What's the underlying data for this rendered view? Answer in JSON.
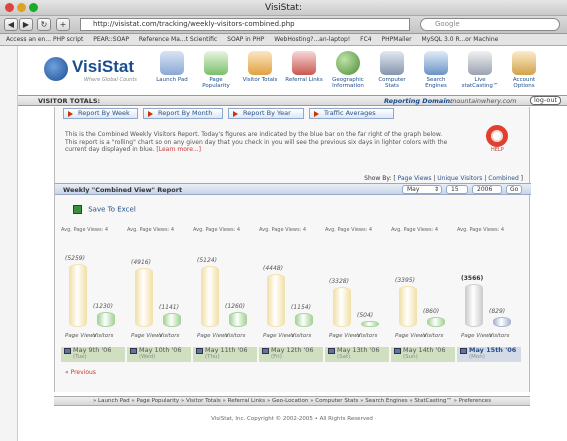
{
  "window": {
    "title": "VisiStat:"
  },
  "browser": {
    "url": "http://visistat.com/tracking/weekly-visitors-combined.php",
    "search_placeholder": "Google",
    "bookmarks": [
      "Access an en... PHP script",
      "PEAR::SOAP",
      "Reference Ma...t Scientific",
      "SOAP in PHP",
      "WebHosting?...an-laptop!",
      "FC4",
      "PHPMailer",
      "MySQL 3.0 R...or Machine"
    ]
  },
  "app": {
    "logo_text": "VisiStat",
    "tagline": "Where Global Counts",
    "nav": [
      {
        "label": "Launch Pad",
        "icon": "rocket-icon"
      },
      {
        "label": "Page Popularity",
        "icon": "page-icon"
      },
      {
        "label": "Visitor Totals",
        "icon": "bar-chart-icon"
      },
      {
        "label": "Referral Links",
        "icon": "funnel-icon"
      },
      {
        "label": "Geographic Information",
        "icon": "globe-icon"
      },
      {
        "label": "Computer Stats",
        "icon": "computer-icon"
      },
      {
        "label": "Search Engines",
        "icon": "magnifier-icon"
      },
      {
        "label": "Live statCasting™",
        "icon": "satellite-icon"
      },
      {
        "label": "Account Options",
        "icon": "gears-icon"
      }
    ],
    "totals_label": "VISITOR TOTALS:",
    "reporting_domain_label": "Reporting Domain:",
    "reporting_domain": "mountainwhery.com",
    "logout_label": "log-out"
  },
  "tabs": [
    "Report By Week",
    "Report By Month",
    "Report By Year",
    "Traffic Averages"
  ],
  "intro": {
    "text": "This is the Combined Weekly Visitors Report. Today's figures are indicated by the blue bar on the far right of the graph below. This report is a \"rolling\" chart so on any given day that you check in you will see the previous six days in lighter colors with the current day displayed in blue.",
    "learn_more": "[Learn more...]",
    "help_label": "HELP"
  },
  "showby": {
    "label": "Show By:",
    "options": [
      "Page Views",
      "Unique Visitors",
      "Combined"
    ]
  },
  "report": {
    "title": "Weekly \"Combined View\" Report",
    "month": "May",
    "day": "15",
    "year": "2006",
    "go": "Go",
    "export": "Save To Excel"
  },
  "chart_data": {
    "type": "bar",
    "column_headers": [
      "Avg. Page Views: 4",
      "Avg. Page Views: 4",
      "Avg. Page Views: 4",
      "Avg. Page Views: 4",
      "Avg. Page Views: 4",
      "Avg. Page Views: 4",
      "Avg. Page Views: 4"
    ],
    "categories": [
      "May 9th '06",
      "May 10th '06",
      "May 11th '06",
      "May 12th '06",
      "May 13th '06",
      "May 14th '06",
      "May 15th '06"
    ],
    "day_names": [
      "Tue",
      "Wed",
      "Thu",
      "Fri",
      "Sat",
      "Sun",
      "Mon"
    ],
    "series": [
      {
        "name": "Page Views",
        "values": [
          5259,
          4916,
          5124,
          4448,
          3328,
          3395,
          3566
        ],
        "labels": [
          "(5259)",
          "(4916)",
          "(5124)",
          "(4448)",
          "(3328)",
          "(3395)",
          "(3566)"
        ]
      },
      {
        "name": "Visitors",
        "values": [
          1230,
          1141,
          1260,
          1154,
          504,
          860,
          829
        ],
        "labels": [
          "(1230)",
          "(1141)",
          "(1260)",
          "(1154)",
          "(504)",
          "(860)",
          "(829)"
        ]
      }
    ],
    "ylim": [
      0,
      6000
    ],
    "current_index": 6,
    "colors": {
      "page_views": "#f2e2ad",
      "visitors": "#a8d49b",
      "current_page_views": "#cfcfcf",
      "current_visitors": "#a9b6d4"
    }
  },
  "previous_label": "« Previous",
  "footer": {
    "nav": "» Launch Pad  » Page Popularity  » Visitor Totals  » Referral Links  » Geo-Location  » Computer Stats  » Search Engines  » StatCasting™  » Preferences",
    "copyright": "VisiStat, Inc. Copyright © 2002-2005 • All Rights Reserved"
  }
}
